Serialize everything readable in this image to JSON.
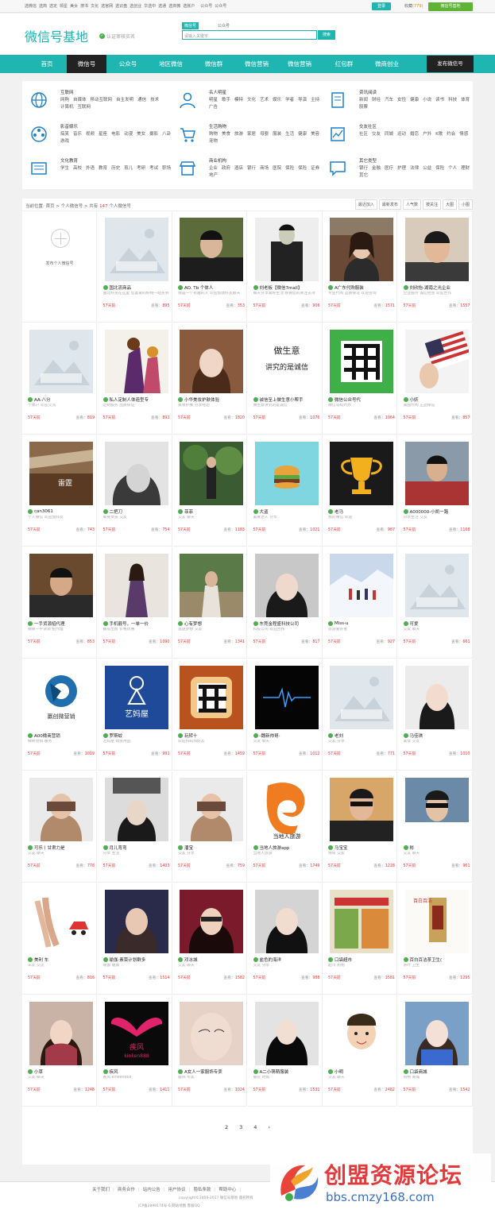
{
  "topbar": {
    "links": [
      "选微信",
      "选简",
      "选定",
      "领星",
      "美女",
      "搜书",
      "文化",
      "选官网",
      "选识盘",
      "选创业",
      "华选中",
      "选通",
      "选商微",
      "选账户"
    ],
    "links2": [
      "公众号",
      "公众号"
    ],
    "login_label": "登录",
    "vip_prefix": "收藏",
    "vip_count": "(779)",
    "wx_label": "微信号基地"
  },
  "header": {
    "logo": "微信号基地",
    "slogan": "认证审核实名",
    "search_tab_active": "微信号",
    "search_tab_other": "公众号",
    "search_placeholder": "请输入关键字",
    "search_button": "搜索"
  },
  "nav": {
    "items": [
      "首页",
      "微信号",
      "公众号",
      "地区微信",
      "微信群",
      "微信营销",
      "微信营销",
      "红包群",
      "微商创业"
    ],
    "publish": "发布微信号"
  },
  "categories": [
    {
      "title": "互联网",
      "icon": "globe-icon",
      "tags": [
        "网购",
        "自媒体",
        "移动互联网",
        "自主发明",
        "通信",
        "技术",
        "计算机",
        "互联网"
      ]
    },
    {
      "title": "名人明星",
      "icon": "person-icon",
      "tags": [
        "明星",
        "歌手",
        "模特",
        "文化",
        "艺术",
        "娱乐",
        "学者",
        "导演",
        "主持",
        "广告"
      ]
    },
    {
      "title": "资讯阅读",
      "icon": "book-icon",
      "tags": [
        "新闻",
        "财经",
        "汽车",
        "女性",
        "健康",
        "小说",
        "读书",
        "科技",
        "体育",
        "股票"
      ]
    },
    {
      "title": "影音娱乐",
      "icon": "film-icon",
      "tags": [
        "搞笑",
        "音乐",
        "视频",
        "星座",
        "电影",
        "动漫",
        "美女",
        "摄影",
        "八卦",
        "游戏"
      ]
    },
    {
      "title": "生活购物",
      "icon": "cart-icon",
      "tags": [
        "购物",
        "美食",
        "旅游",
        "家居",
        "母婴",
        "服装",
        "生活",
        "健康",
        "美容",
        "宠物"
      ]
    },
    {
      "title": "交友社区",
      "icon": "chart-icon",
      "tags": [
        "社区",
        "交友",
        "同城",
        "运动",
        "婚恋",
        "户外",
        "K歌",
        "约会",
        "情感"
      ]
    },
    {
      "title": "文化教育",
      "icon": "news-icon",
      "tags": [
        "学生",
        "高校",
        "外语",
        "教育",
        "历史",
        "育儿",
        "考研",
        "考试",
        "职场"
      ]
    },
    {
      "title": "商业机构",
      "icon": "shop-icon",
      "tags": [
        "企业",
        "政府",
        "酒店",
        "银行",
        "商场",
        "医院",
        "保险",
        "保险",
        "证券",
        "地产"
      ]
    },
    {
      "title": "其它类型",
      "icon": "chat-icon",
      "tags": [
        "银行",
        "金融",
        "医疗",
        "护理",
        "法律",
        "公益",
        "保险",
        "个人",
        "理财",
        "其它"
      ]
    }
  ],
  "breadcrumb": {
    "prefix": "当前位置: 首页 > 个人微信号 > 共有",
    "count": "147",
    "suffix": "个人微信号",
    "sorts": [
      "最近加入",
      "最新发布",
      "人气数",
      "按关注",
      "大图",
      "小图"
    ]
  },
  "add_card_label": "发布个人微信号",
  "cards": [
    {
      "name": "国北流商品",
      "desc": "国北好货在这里 您喜爱的好物一站买到",
      "added": "57天前",
      "views": "895",
      "img": "placeholder"
    },
    {
      "name": "AO. Tb 个体人",
      "desc": "我是一个有趣的人 欢迎加我好友聊天",
      "added": "57天前",
      "views": "353",
      "img": "man"
    },
    {
      "name": "刘老板【微信7mall】",
      "desc": "每天分享美好生活 感谢您的关注支持",
      "added": "57天前",
      "views": "906",
      "img": "man2"
    },
    {
      "name": "A广东代购服装",
      "desc": "专业代购 品质保证 欢迎咨询",
      "added": "57天前",
      "views": "1571",
      "img": "woman"
    },
    {
      "name": "刘欣怡-湖南之光企业",
      "desc": "企业服务 诚信经营 欢迎合作",
      "added": "57天前",
      "views": "1557",
      "img": "man3"
    },
    {
      "name": "AA-八分",
      "desc": "个体户 欢迎交流",
      "added": "57天前",
      "views": "819",
      "img": "placeholder"
    },
    {
      "name": "私人定制人体造型专",
      "desc": "定制服务 品质保证",
      "added": "57天前",
      "views": "892",
      "img": "art"
    },
    {
      "name": "小华美妆护肤体验",
      "desc": "美妆护肤 分享经验",
      "added": "57天前",
      "views": "1820",
      "img": "girl"
    },
    {
      "name": "诚信至上做生意小帮手",
      "desc": "做生意讲究的是诚信",
      "added": "57天前",
      "views": "1076",
      "img": "text"
    },
    {
      "name": "微信公众号代",
      "desc": "微信号码代办",
      "added": "57天前",
      "views": "1064",
      "img": "qr"
    },
    {
      "name": "小妖",
      "desc": "美国代购 正品保证",
      "added": "57天前",
      "views": "857",
      "img": "flag"
    },
    {
      "name": "can3061",
      "desc": "个人微信 欢迎加好友",
      "added": "57天前",
      "views": "743",
      "img": "game"
    },
    {
      "name": "二把刀",
      "desc": "单身女孩 交友",
      "added": "57天前",
      "views": "754",
      "img": "bw"
    },
    {
      "name": "菲菲",
      "desc": "交友 聊天",
      "added": "57天前",
      "views": "1183",
      "img": "tree"
    },
    {
      "name": "大盗",
      "desc": "美食达人 分享",
      "added": "57天前",
      "views": "1021",
      "img": "burger"
    },
    {
      "name": "老马",
      "desc": "我的微信 欢迎",
      "added": "57天前",
      "views": "987",
      "img": "trophy"
    },
    {
      "name": "A000000-小凯一路",
      "desc": "分享生活 交友",
      "added": "57天前",
      "views": "1168",
      "img": "man4"
    },
    {
      "name": "一手货源招代理",
      "desc": "微商一手货源 招代理",
      "added": "57天前",
      "views": "853",
      "img": "man5"
    },
    {
      "name": "手机靓号，一单一价",
      "desc": "靓号出售 价格优惠",
      "added": "57天前",
      "views": "1090",
      "img": "woman2"
    },
    {
      "name": "心有梦想",
      "desc": "追逐梦想 交友",
      "added": "57天前",
      "views": "1341",
      "img": "woman3"
    },
    {
      "name": "东莞金程盛科技公司",
      "desc": "科技公司 欢迎合作",
      "added": "57天前",
      "views": "817",
      "img": "woman4"
    },
    {
      "name": "Miss-u",
      "desc": "旅游爱好者",
      "added": "57天前",
      "views": "927",
      "img": "snow"
    },
    {
      "name": "可爱",
      "desc": "交友 聊天",
      "added": "57天前",
      "views": "661",
      "img": "placeholder"
    },
    {
      "name": "A00微商营销",
      "desc": "微商营销 服务",
      "added": "57天前",
      "views": "1019",
      "img": "camera"
    },
    {
      "name": "罗斯蚊",
      "desc": "艺妈屋 母婴用品",
      "added": "57天前",
      "views": "991",
      "img": "yima"
    },
    {
      "name": "玩转十",
      "desc": "欢迎扫码加好友",
      "added": "57天前",
      "views": "1459",
      "img": "toast"
    },
    {
      "name": "-魏新帅哥-",
      "desc": "交友 聊天",
      "added": "57天前",
      "views": "1012",
      "img": "dark"
    },
    {
      "name": "老刘",
      "desc": "交友 分享",
      "added": "57天前",
      "views": "771",
      "img": "placeholder"
    },
    {
      "name": "马佳琪",
      "desc": "美女 交友",
      "added": "57天前",
      "views": "1010",
      "img": "girl2"
    },
    {
      "name": "可乐丨甘肃力是",
      "desc": "交友 聊天",
      "added": "57天前",
      "views": "778",
      "img": "hide"
    },
    {
      "name": "月儿弯弯",
      "desc": "分享 生活",
      "added": "57天前",
      "views": "1403",
      "img": "woman5"
    },
    {
      "name": "潘宝",
      "desc": "交友 分享",
      "added": "57天前",
      "views": "759",
      "img": "hide"
    },
    {
      "name": "当地人旅游app",
      "desc": "当地人旅游",
      "added": "57天前",
      "views": "1749",
      "img": "travel"
    },
    {
      "name": "马宝宝",
      "desc": "帅哥 交友",
      "added": "57天前",
      "views": "1228",
      "img": "man6"
    },
    {
      "name": "彬",
      "desc": "交友 聊天",
      "added": "57天前",
      "views": "961",
      "img": "man7"
    },
    {
      "name": "美利 车",
      "desc": "车友 交流",
      "added": "57天前",
      "views": "816",
      "img": "car"
    },
    {
      "name": "瑜伽·素菜计划群多",
      "desc": "瑜伽 健康",
      "added": "57天前",
      "views": "1514",
      "img": "woman6"
    },
    {
      "name": "邓冰城",
      "desc": "交友 聊天",
      "added": "57天前",
      "views": "1582",
      "img": "woman7"
    },
    {
      "name": "盐色的海洋",
      "desc": "交友 分享",
      "added": "57天前",
      "views": "988",
      "img": "woman8"
    },
    {
      "name": "口袋超市",
      "desc": "超市 购物",
      "added": "57天前",
      "views": "1581",
      "img": "store"
    },
    {
      "name": "百白百洁茶卫生(",
      "desc": "茶叶 卫生",
      "added": "57天前",
      "views": "1295",
      "img": "tea"
    },
    {
      "name": "小草",
      "desc": "交友 聊天",
      "added": "57天前",
      "views": "1248",
      "img": "woman9"
    },
    {
      "name": "疾风",
      "desc": "疾风 kinken888",
      "added": "57天前",
      "views": "1411",
      "img": "wings"
    },
    {
      "name": "A女人一家服饰专卖",
      "desc": "服饰 专卖",
      "added": "57天前",
      "views": "1024",
      "img": "close"
    },
    {
      "name": "A二小萌萌服装",
      "desc": "服装 时尚",
      "added": "57天前",
      "views": "1531",
      "img": "woman10"
    },
    {
      "name": "小明",
      "desc": "交友 聊天",
      "added": "57天前",
      "views": "2482",
      "img": "cartoon"
    },
    {
      "name": "口袋商城",
      "desc": "购物 商城",
      "added": "57天前",
      "views": "1542",
      "img": "girl3"
    }
  ],
  "pager": [
    "2",
    "3",
    "4",
    "›"
  ],
  "footer": {
    "links": [
      "关于我们",
      "商务合作",
      "站内公告",
      "用户协议",
      "隐私条款",
      "帮助中心"
    ],
    "copy1": "copyright©2009-2017 微信号基地 版权所有",
    "copy2": "ICP备2899174号-6 网站地图 客服QQ"
  },
  "watermark": {
    "title": "创盟资源论坛",
    "url": "bbs.cmzy168.com"
  }
}
